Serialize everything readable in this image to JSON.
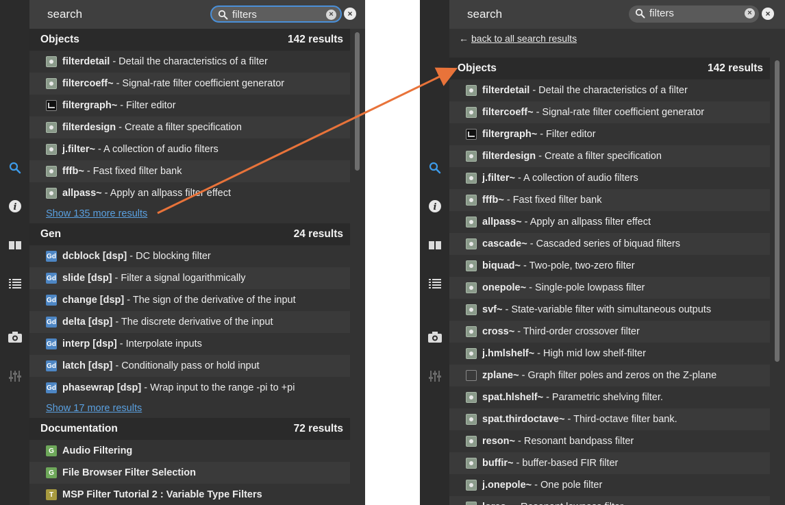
{
  "search": {
    "title": "search",
    "query": "filters",
    "clear_glyph": "×",
    "close_glyph": "×",
    "icons": [
      "search-icon",
      "clear-icon",
      "close-icon"
    ]
  },
  "rail_icons": [
    "search-icon",
    "info-icon",
    "book-icon",
    "list-icon",
    "camera-icon",
    "mixer-icon"
  ],
  "left_panel": {
    "sections": [
      {
        "title": "Objects",
        "count": "142 results",
        "items": [
          {
            "icon": "object-icon",
            "name": "filterdetail",
            "desc": " - Detail the characteristics of a filter"
          },
          {
            "icon": "object-icon",
            "name": "filtercoeff~",
            "desc": " - Signal-rate filter coefficient generator"
          },
          {
            "icon": "graph-icon",
            "name": "filtergraph~",
            "desc": " - Filter editor"
          },
          {
            "icon": "object-icon",
            "name": "filterdesign",
            "desc": " - Create a filter specification"
          },
          {
            "icon": "object-icon",
            "name": "j.filter~",
            "desc": " - A collection of audio filters"
          },
          {
            "icon": "object-icon",
            "name": "fffb~",
            "desc": " - Fast fixed filter bank"
          },
          {
            "icon": "object-icon",
            "name": "allpass~",
            "desc": " - Apply an allpass filter effect"
          }
        ],
        "more": "Show 135 more results"
      },
      {
        "title": "Gen",
        "count": "24 results",
        "items": [
          {
            "icon": "gen-icon",
            "name": "dcblock [dsp]",
            "desc": " - DC blocking filter"
          },
          {
            "icon": "gen-icon",
            "name": "slide [dsp]",
            "desc": " - Filter a signal logarithmically"
          },
          {
            "icon": "gen-icon",
            "name": "change [dsp]",
            "desc": " - The sign of the derivative of the input"
          },
          {
            "icon": "gen-icon",
            "name": "delta [dsp]",
            "desc": " - The discrete derivative of the input"
          },
          {
            "icon": "gen-icon",
            "name": "interp [dsp]",
            "desc": " - Interpolate inputs"
          },
          {
            "icon": "gen-icon",
            "name": "latch [dsp]",
            "desc": " - Conditionally pass or hold input"
          },
          {
            "icon": "gen-icon",
            "name": "phasewrap [dsp]",
            "desc": " - Wrap input to the range -pi to +pi"
          }
        ],
        "more": "Show 17 more results"
      },
      {
        "title": "Documentation",
        "count": "72 results",
        "items": [
          {
            "icon": "doc-icon",
            "name": "Audio Filtering",
            "desc": ""
          },
          {
            "icon": "doc-icon",
            "name": "File Browser Filter Selection",
            "desc": ""
          },
          {
            "icon": "tutorial-icon",
            "name": "MSP Filter Tutorial 2 : Variable Type Filters",
            "desc": ""
          }
        ],
        "more": ""
      }
    ]
  },
  "right_panel": {
    "back_arrow": "←",
    "back_label": "back to all search results",
    "section": {
      "title": "Objects",
      "count": "142 results",
      "items": [
        {
          "icon": "object-icon",
          "name": "filterdetail",
          "desc": " - Detail the characteristics of a filter"
        },
        {
          "icon": "object-icon",
          "name": "filtercoeff~",
          "desc": " - Signal-rate filter coefficient generator"
        },
        {
          "icon": "graph-icon",
          "name": "filtergraph~",
          "desc": " - Filter editor"
        },
        {
          "icon": "object-icon",
          "name": "filterdesign",
          "desc": " - Create a filter specification"
        },
        {
          "icon": "object-icon",
          "name": "j.filter~",
          "desc": " - A collection of audio filters"
        },
        {
          "icon": "object-icon",
          "name": "fffb~",
          "desc": " - Fast fixed filter bank"
        },
        {
          "icon": "object-icon",
          "name": "allpass~",
          "desc": " - Apply an allpass filter effect"
        },
        {
          "icon": "object-icon",
          "name": "cascade~",
          "desc": " - Cascaded series of biquad filters"
        },
        {
          "icon": "object-icon",
          "name": "biquad~",
          "desc": " - Two-pole, two-zero filter"
        },
        {
          "icon": "object-icon",
          "name": "onepole~",
          "desc": " - Single-pole lowpass filter"
        },
        {
          "icon": "object-icon",
          "name": "svf~",
          "desc": " - State-variable filter with simultaneous outputs"
        },
        {
          "icon": "object-icon",
          "name": "cross~",
          "desc": " - Third-order crossover filter"
        },
        {
          "icon": "object-icon",
          "name": "j.hmlshelf~",
          "desc": " - High mid low shelf-filter"
        },
        {
          "icon": "zplane-icon",
          "name": "zplane~",
          "desc": " - Graph filter poles and zeros on the Z-plane"
        },
        {
          "icon": "object-icon",
          "name": "spat.hlshelf~",
          "desc": " - Parametric shelving filter."
        },
        {
          "icon": "object-icon",
          "name": "spat.thirdoctave~",
          "desc": " - Third-octave filter bank."
        },
        {
          "icon": "object-icon",
          "name": "reson~",
          "desc": " - Resonant bandpass filter"
        },
        {
          "icon": "object-icon",
          "name": "buffir~",
          "desc": " - buffer-based FIR filter"
        },
        {
          "icon": "object-icon",
          "name": "j.onepole~",
          "desc": " - One pole filter"
        },
        {
          "icon": "object-icon",
          "name": "lores~",
          "desc": " - Resonant lowpass filter"
        }
      ]
    }
  },
  "colors": {
    "accent": "#4a90d9",
    "link": "#5aa0e0",
    "arrow": "#e8733a",
    "panel_bg": "#333333",
    "section_bg": "#2a2a2a"
  }
}
